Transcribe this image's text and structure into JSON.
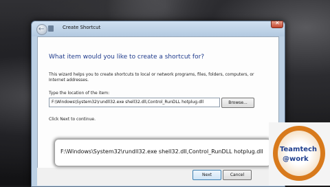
{
  "window": {
    "title": "Create Shortcut",
    "back_glyph": "←",
    "close_glyph": "✕"
  },
  "wizard": {
    "heading": "What item would you like to create a shortcut for?",
    "intro": "This wizard helps you to create shortcuts to local or network programs, files, folders, computers, or Internet addresses.",
    "location_label": "Type the location of the item:",
    "location_value": "F:\\Windows\\System32\\rundll32.exe shell32.dll,Control_RunDLL hotplug.dll",
    "browse_label": "Browse...",
    "hint": "Click Next to continue.",
    "next_label": "Next",
    "cancel_label": "Cancel"
  },
  "callout": {
    "text": "F:\\Windows\\System32\\rundll32.exe shell32.dll,Control_RunDLL hotplug.dll"
  },
  "logo": {
    "line1": "Teamtech",
    "line2": "@work"
  },
  "colors": {
    "heading": "#1e3a8c",
    "logo_ring": "#d87a1c",
    "logo_text": "#1f3f8e"
  }
}
